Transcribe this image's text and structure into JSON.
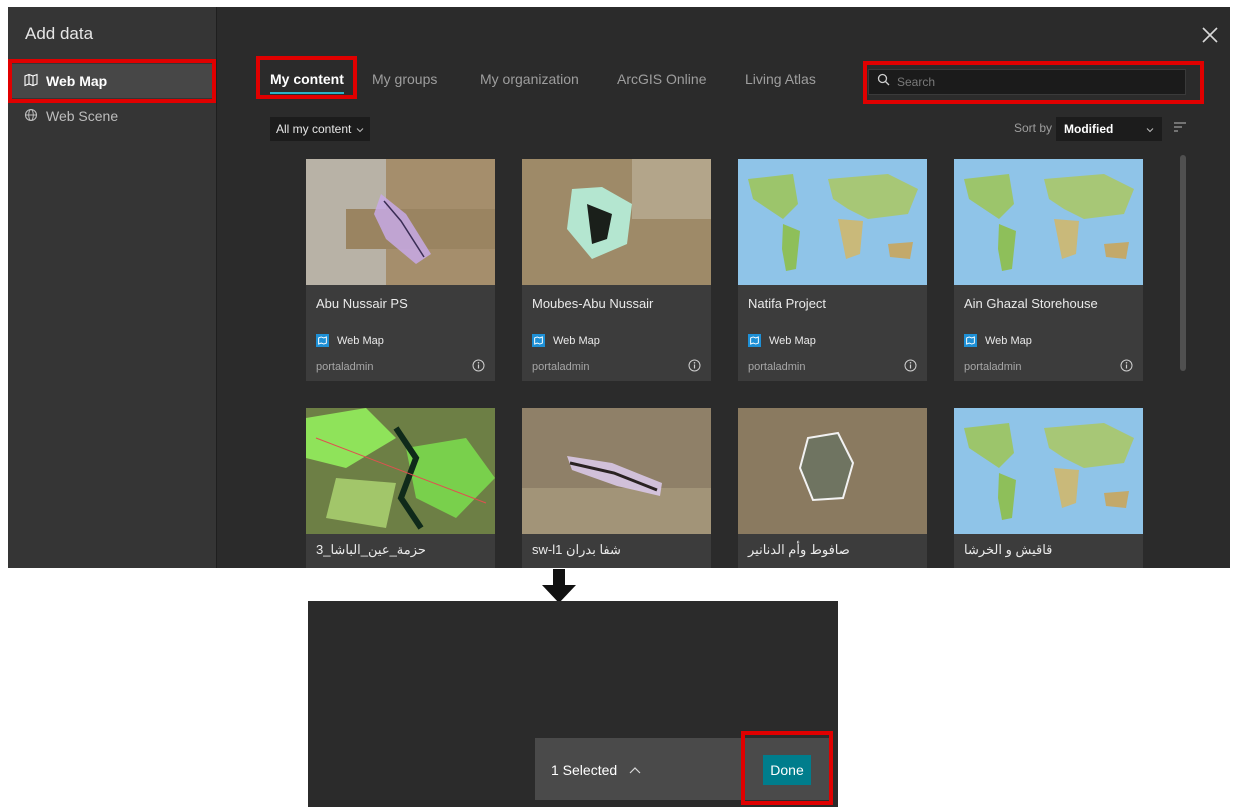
{
  "sidebar": {
    "title": "Add data",
    "items": [
      {
        "label": "Web Map",
        "icon": "map-icon"
      },
      {
        "label": "Web Scene",
        "icon": "globe-icon"
      }
    ]
  },
  "tabs": [
    "My content",
    "My groups",
    "My organization",
    "ArcGIS Online",
    "Living Atlas"
  ],
  "search": {
    "placeholder": "Search"
  },
  "filter": {
    "label": "All my content"
  },
  "sort": {
    "label": "Sort by",
    "value": "Modified"
  },
  "cards": [
    {
      "title": "Abu Nussair PS",
      "type": "Web Map",
      "owner": "portaladmin"
    },
    {
      "title": "Moubes-Abu Nussair",
      "type": "Web Map",
      "owner": "portaladmin"
    },
    {
      "title": "Natifa Project",
      "type": "Web Map",
      "owner": "portaladmin"
    },
    {
      "title": "Ain Ghazal Storehouse",
      "type": "Web Map",
      "owner": "portaladmin"
    },
    {
      "title": "حزمة_عين_الباشا_3"
    },
    {
      "title": "sw-l1 شفا بدران"
    },
    {
      "title": "صافوط وأم الدنانير"
    },
    {
      "title": "قاقيش و الخرشا"
    }
  ],
  "selection": {
    "count_label": "1 Selected",
    "done_label": "Done"
  },
  "colors": {
    "accent": "#2ab3c8",
    "done": "#007d8c",
    "highlight": "#e00000",
    "type_badge": "#1e90d6"
  }
}
